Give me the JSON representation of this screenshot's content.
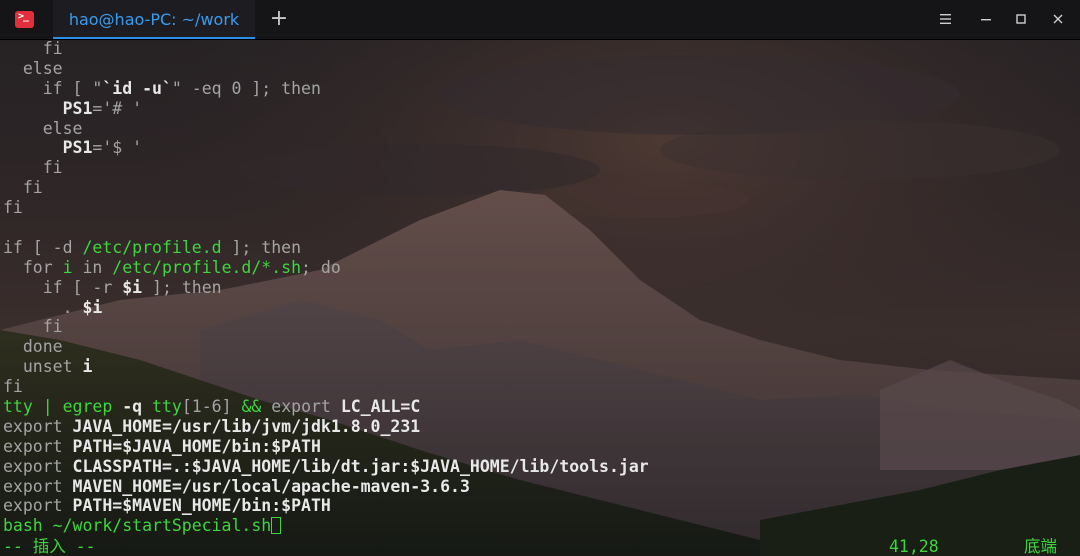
{
  "window": {
    "tab_title": "hao@hao-PC: ~/work",
    "new_tab_glyph": "+"
  },
  "icons": {
    "app": "terminal-icon",
    "menu": "hamburger-menu-icon",
    "minimize": "minimize-icon",
    "maximize": "maximize-icon",
    "close": "close-icon"
  },
  "colors": {
    "tab_accent": "#3a9cf0",
    "app_icon": "#e0303b",
    "green": "#3fd53f"
  },
  "terminal": {
    "lines": [
      [
        {
          "t": "    fi",
          "c": "c-gray"
        }
      ],
      [
        {
          "t": "  else",
          "c": "c-gray"
        }
      ],
      [
        {
          "t": "    if [ \"",
          "c": "c-gray"
        },
        {
          "t": "`id -u`",
          "c": "c-white"
        },
        {
          "t": "\" -eq ",
          "c": "c-gray"
        },
        {
          "t": "0",
          "c": "c-gray"
        },
        {
          "t": " ]; then",
          "c": "c-gray"
        }
      ],
      [
        {
          "t": "      ",
          "c": "c-gray"
        },
        {
          "t": "PS1",
          "c": "c-white"
        },
        {
          "t": "='# '",
          "c": "c-gray"
        }
      ],
      [
        {
          "t": "    else",
          "c": "c-gray"
        }
      ],
      [
        {
          "t": "      ",
          "c": "c-gray"
        },
        {
          "t": "PS1",
          "c": "c-white"
        },
        {
          "t": "='$ '",
          "c": "c-gray"
        }
      ],
      [
        {
          "t": "    fi",
          "c": "c-gray"
        }
      ],
      [
        {
          "t": "  fi",
          "c": "c-gray"
        }
      ],
      [
        {
          "t": "fi",
          "c": "c-gray"
        }
      ],
      [
        {
          "t": "",
          "c": "c-gray"
        }
      ],
      [
        {
          "t": "if [ -d ",
          "c": "c-gray"
        },
        {
          "t": "/etc/profile.d",
          "c": "c-green"
        },
        {
          "t": " ]; then",
          "c": "c-gray"
        }
      ],
      [
        {
          "t": "  for ",
          "c": "c-gray"
        },
        {
          "t": "i",
          "c": "c-green"
        },
        {
          "t": " in ",
          "c": "c-gray"
        },
        {
          "t": "/etc/profile.d/*.sh",
          "c": "c-green"
        },
        {
          "t": "; do",
          "c": "c-gray"
        }
      ],
      [
        {
          "t": "    if [ -r ",
          "c": "c-gray"
        },
        {
          "t": "$i",
          "c": "c-white"
        },
        {
          "t": " ]; then",
          "c": "c-gray"
        }
      ],
      [
        {
          "t": "      . ",
          "c": "c-gray"
        },
        {
          "t": "$i",
          "c": "c-white"
        }
      ],
      [
        {
          "t": "    fi",
          "c": "c-gray"
        }
      ],
      [
        {
          "t": "  done",
          "c": "c-gray"
        }
      ],
      [
        {
          "t": "  unset ",
          "c": "c-gray"
        },
        {
          "t": "i",
          "c": "c-white"
        }
      ],
      [
        {
          "t": "fi",
          "c": "c-gray"
        }
      ],
      [
        {
          "t": "tty | egrep ",
          "c": "c-green"
        },
        {
          "t": "-q",
          "c": "c-white"
        },
        {
          "t": " tty",
          "c": "c-green"
        },
        {
          "t": "[1-6]",
          "c": "c-gray"
        },
        {
          "t": " && ",
          "c": "c-green"
        },
        {
          "t": "export ",
          "c": "c-gray"
        },
        {
          "t": "LC_ALL=C",
          "c": "c-white"
        }
      ],
      [
        {
          "t": "export ",
          "c": "c-gray"
        },
        {
          "t": "JAVA_HOME=/usr/lib/jvm/jdk1.8.0_231",
          "c": "c-white"
        }
      ],
      [
        {
          "t": "export ",
          "c": "c-gray"
        },
        {
          "t": "PATH=$JAVA_HOME/bin:$PATH",
          "c": "c-white"
        }
      ],
      [
        {
          "t": "export ",
          "c": "c-gray"
        },
        {
          "t": "CLASSPATH=.:$JAVA_HOME/lib/dt.jar:$JAVA_HOME/lib/tools.jar",
          "c": "c-white"
        }
      ],
      [
        {
          "t": "export ",
          "c": "c-gray"
        },
        {
          "t": "MAVEN_HOME=/usr/local/apache-maven-3.6.3",
          "c": "c-white"
        }
      ],
      [
        {
          "t": "export ",
          "c": "c-gray"
        },
        {
          "t": "PATH=$MAVEN_HOME/bin:$PATH",
          "c": "c-white"
        }
      ],
      [
        {
          "t": "bash ~/work/startSpecial.sh",
          "c": "c-green"
        }
      ]
    ],
    "status": {
      "mode": "-- 插入 --",
      "position": "41,28",
      "location": "底端"
    }
  }
}
